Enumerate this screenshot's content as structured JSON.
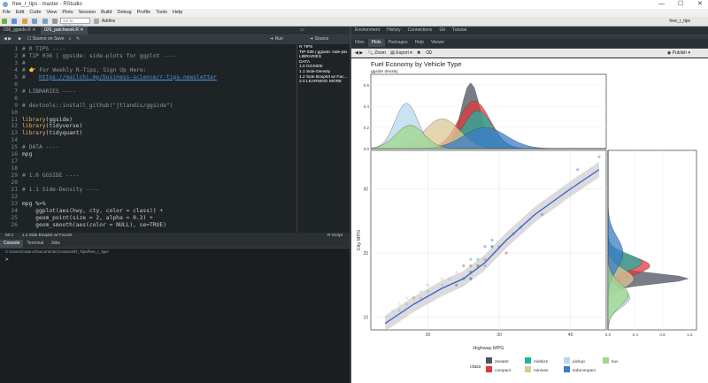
{
  "window": {
    "title": "free_r_tips - master - RStudio"
  },
  "menu": [
    "File",
    "Edit",
    "Code",
    "View",
    "Plots",
    "Session",
    "Build",
    "Debug",
    "Profile",
    "Tools",
    "Help"
  ],
  "toolbar": {
    "goto_placeholder": "Go to file/function",
    "addins": "Addins",
    "project": "free_r_tips"
  },
  "editor": {
    "tabs": [
      "036_ggside.R",
      "026_patchwork.R"
    ],
    "source_on_save": "Source on Save",
    "run": "Run",
    "source": "Source",
    "status_pos": "50:1",
    "status_section": "1.2 Side Boxplot w/ Facets",
    "status_type": "R Script",
    "lines": [
      {
        "n": "1",
        "t": "# R TIPS ----"
      },
      {
        "n": "2",
        "t": "# TIP 036 | ggside: side-plots for ggplot ----"
      },
      {
        "n": "3",
        "t": "#"
      },
      {
        "n": "4",
        "t": "# 👉 For Weekly R-Tips, Sign Up Here:"
      },
      {
        "n": "5",
        "t": "#    https://mailchi.mp/business-science/r-tips-newsletter"
      },
      {
        "n": "6",
        "t": ""
      },
      {
        "n": "7",
        "t": "# LIBRARIES ----"
      },
      {
        "n": "8",
        "t": ""
      },
      {
        "n": "9",
        "t": "# devtools::install_github(\"jtlandis/ggside\")"
      },
      {
        "n": "10",
        "t": ""
      },
      {
        "n": "11",
        "t": "library(ggside)"
      },
      {
        "n": "12",
        "t": "library(tidyverse)"
      },
      {
        "n": "13",
        "t": "library(tidyquant)"
      },
      {
        "n": "14",
        "t": ""
      },
      {
        "n": "15",
        "t": "# DATA ----"
      },
      {
        "n": "16",
        "t": "mpg"
      },
      {
        "n": "17",
        "t": ""
      },
      {
        "n": "18",
        "t": ""
      },
      {
        "n": "19",
        "t": "# 1.0 GGSIDE ----"
      },
      {
        "n": "20",
        "t": ""
      },
      {
        "n": "21",
        "t": "# 1.1 Side-Density ----"
      },
      {
        "n": "22",
        "t": ""
      },
      {
        "n": "23",
        "t": "mpg %>%"
      },
      {
        "n": "24",
        "t": "    ggplot(aes(hwy, cty, color = class)) +"
      },
      {
        "n": "25",
        "t": "    geom_point(size = 2, alpha = 0.3) +"
      },
      {
        "n": "26",
        "t": "    geom_smooth(aes(color = NULL), se=TRUE)"
      }
    ]
  },
  "outline": [
    "R TIPS",
    "TIP 036 | ggside: side-plots...",
    "LIBRARIES",
    "DATA",
    "1.0 GGSIDE",
    "1.1 Side-Density",
    "1.2 Side Boxplot w/ Fac...",
    "2.0 LEARNING MORE"
  ],
  "console": {
    "tabs": [
      "Console",
      "Terminal",
      "Jobs"
    ],
    "path": "C:/Users/mdanc/Documents/Contacts/R_Tips/free_r_tips/",
    "prompt": ">"
  },
  "env_tabs": [
    "Environment",
    "History",
    "Connections",
    "Git",
    "Tutorial"
  ],
  "files_tabs": [
    "Files",
    "Plots",
    "Packages",
    "Help",
    "Viewer"
  ],
  "plot_toolbar": {
    "zoom": "Zoom",
    "export": "Export",
    "publish": "Publish"
  },
  "chart_data": {
    "type": "scatter",
    "title": "Fuel Economy by Vehicle Type",
    "subtitle": "ggside density",
    "xlabel": "Highway MPG",
    "ylabel": "City MPG",
    "xticks": [
      "20",
      "30",
      "40"
    ],
    "yticks": [
      "10",
      "20",
      "30"
    ],
    "side_x_ticks": [
      "0.0",
      "0.4",
      "0.8",
      "1.2"
    ],
    "side_y_ticks": [
      "0.0",
      "0.2",
      "0.4",
      "0.6"
    ],
    "xlim": [
      12,
      45
    ],
    "ylim": [
      8,
      36
    ],
    "legend_title": "class",
    "legend": [
      {
        "name": "2seater",
        "color": "#4b5260"
      },
      {
        "name": "compact",
        "color": "#e03a3a"
      },
      {
        "name": "midsize",
        "color": "#20b2a0"
      },
      {
        "name": "minivan",
        "color": "#dcc898"
      },
      {
        "name": "pickup",
        "color": "#b8d8ec"
      },
      {
        "name": "subcompact",
        "color": "#3a7cc8"
      },
      {
        "name": "suv",
        "color": "#9fd88a"
      }
    ],
    "smooth": [
      [
        14,
        9
      ],
      [
        18,
        12
      ],
      [
        22,
        14.5
      ],
      [
        25,
        16
      ],
      [
        28,
        18.5
      ],
      [
        31,
        22
      ],
      [
        35,
        26
      ],
      [
        40,
        30
      ],
      [
        44,
        33
      ]
    ],
    "points": [
      [
        26,
        18,
        "compact"
      ],
      [
        29,
        21,
        "compact"
      ],
      [
        31,
        20,
        "compact"
      ],
      [
        30,
        21,
        "compact"
      ],
      [
        26,
        16,
        "compact"
      ],
      [
        27,
        18,
        "compact"
      ],
      [
        25,
        18,
        "compact"
      ],
      [
        28,
        19,
        "compact"
      ],
      [
        26,
        17,
        "2seater"
      ],
      [
        26,
        16,
        "2seater"
      ],
      [
        24,
        15,
        "2seater"
      ],
      [
        25,
        16,
        "2seater"
      ],
      [
        27,
        18,
        "midsize"
      ],
      [
        26,
        19,
        "midsize"
      ],
      [
        29,
        21,
        "midsize"
      ],
      [
        27,
        19,
        "midsize"
      ],
      [
        28,
        18,
        "midsize"
      ],
      [
        26,
        17,
        "midsize"
      ],
      [
        22,
        16,
        "minivan"
      ],
      [
        24,
        17,
        "minivan"
      ],
      [
        23,
        16,
        "minivan"
      ],
      [
        15,
        11,
        "pickup"
      ],
      [
        17,
        13,
        "pickup"
      ],
      [
        19,
        14,
        "pickup"
      ],
      [
        16,
        12,
        "pickup"
      ],
      [
        18,
        13,
        "pickup"
      ],
      [
        32,
        23,
        "subcompact"
      ],
      [
        36,
        26,
        "subcompact"
      ],
      [
        29,
        22,
        "subcompact"
      ],
      [
        33,
        24,
        "subcompact"
      ],
      [
        41,
        33,
        "subcompact"
      ],
      [
        44,
        35,
        "subcompact"
      ],
      [
        28,
        21,
        "subcompact"
      ],
      [
        17,
        12,
        "suv"
      ],
      [
        19,
        13,
        "suv"
      ],
      [
        20,
        14,
        "suv"
      ],
      [
        18,
        13,
        "suv"
      ],
      [
        22,
        15,
        "suv"
      ],
      [
        16,
        11,
        "suv"
      ],
      [
        20,
        15,
        "suv"
      ]
    ]
  }
}
